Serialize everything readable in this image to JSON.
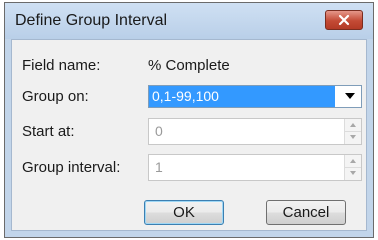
{
  "dialog": {
    "title": "Define Group Interval",
    "close_icon": "close-x-icon"
  },
  "fields": {
    "field_name_label": "Field name:",
    "field_name_value": "% Complete",
    "group_on_label": "Group on:",
    "group_on_value": "0,1-99,100",
    "start_at_label": "Start at:",
    "start_at_value": "0",
    "group_interval_label": "Group interval:",
    "group_interval_value": "1"
  },
  "buttons": {
    "ok_label": "OK",
    "cancel_label": "Cancel"
  },
  "colors": {
    "selection": "#3399ff",
    "close_button": "#c34a35",
    "title_bar": "#c2d5ea"
  }
}
